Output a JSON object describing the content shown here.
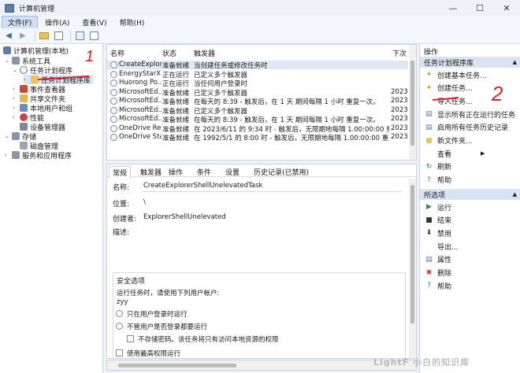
{
  "window": {
    "title": "计算机管理",
    "minimize": "—",
    "maximize": "☐",
    "close": "✕"
  },
  "menu": {
    "file": "文件(F)",
    "action": "操作(A)",
    "view": "查看(V)",
    "help": "帮助(H)"
  },
  "tree": {
    "root": "计算机管理(本地)",
    "system_tools": "系统工具",
    "task_scheduler": "任务计划程序",
    "task_scheduler_library": "任务计划程序库",
    "event_viewer": "事件查看器",
    "shared_folders": "共享文件夹",
    "local_users_groups": "本地用户和组",
    "performance": "性能",
    "device_manager": "设备管理器",
    "storage": "存储",
    "disk_management": "磁盘管理",
    "services_apps": "服务和应用程序"
  },
  "task_list": {
    "headers": {
      "name": "名称",
      "status": "状态",
      "triggers": "触发器",
      "next": "下次"
    },
    "rows": [
      {
        "name": "CreateExplor...",
        "status": "准备就绪",
        "trigger": "当创建任务或修改任务时",
        "next": ""
      },
      {
        "name": "EnergyStarX...",
        "status": "正在运行",
        "trigger": "已定义多个触发器",
        "next": ""
      },
      {
        "name": "Huorong Po...",
        "status": "正在运行",
        "trigger": "当任何用户登录时",
        "next": ""
      },
      {
        "name": "MicrosoftEd...",
        "status": "准备就绪",
        "trigger": "已定义多个触发器",
        "next": "2023,"
      },
      {
        "name": "MicrosoftEd...",
        "status": "准备就绪",
        "trigger": "在每天的 8:39 - 触发后，在 1 天 期间每隔 1 小时 重复一次。",
        "next": "2023,"
      },
      {
        "name": "MicrosoftEd...",
        "status": "准备就绪",
        "trigger": "已定义多个触发器",
        "next": "2023,"
      },
      {
        "name": "MicrosoftEd...",
        "status": "准备就绪",
        "trigger": "在每天的 8:39 - 触发后，在 1 天 期间每隔 1 小时 重复一次。",
        "next": "2023,"
      },
      {
        "name": "OneDrive Re...",
        "status": "准备就绪",
        "trigger": "在 2023/6/11 的 9:34 时 - 触发后，无限期地每隔 1.00:00:00 重复一次。",
        "next": "2023,"
      },
      {
        "name": "OneDrive Sta...",
        "status": "准备就绪",
        "trigger": "在 1992/5/1 的 8:00 时 - 触发后，无限期地每隔 1.00:00:00 重复一次。",
        "next": "2023,"
      }
    ]
  },
  "details": {
    "tabs": [
      "常规",
      "触发器",
      "操作",
      "条件",
      "设置",
      "历史记录(已禁用)"
    ],
    "name_label": "名称:",
    "name_value": "CreateExplorerShellUnelevatedTask",
    "location_label": "位置:",
    "location_value": "\\",
    "author_label": "创建者:",
    "author_value": "ExplorerShellUnelevated",
    "description_label": "描述:",
    "security_title": "安全选项",
    "run_as_label": "运行任务时，请使用下列用户帐户:",
    "run_as_value": "zyy",
    "opt_logged_on": "只在用户登录时运行",
    "opt_whether_logged": "不管用户是否登录都要运行",
    "opt_no_password": "不存储密码。该任务将只有访问本地资源的权限",
    "opt_highest": "使用最高权限运行"
  },
  "actions": {
    "header": "操作",
    "section1": "任务计划程序库",
    "items1": [
      "创建基本任务...",
      "创建任务...",
      "导入任务...",
      "显示所有正在运行的任务",
      "启用所有任务历史记录",
      "新文件夹...",
      "查看",
      "刷新",
      "帮助"
    ],
    "section2": "所选项",
    "items2": [
      "运行",
      "结束",
      "禁用",
      "导出...",
      "属性",
      "删除",
      "帮助"
    ]
  },
  "annotations": {
    "one": "1",
    "two": "2"
  },
  "watermark": "LightF 小白的知识库",
  "icons": [
    "app-icon",
    "back-icon",
    "forward-icon",
    "folder-up-icon",
    "properties-icon",
    "help-icon",
    "clock-icon",
    "folder-icon",
    "delete-icon"
  ],
  "colors": {
    "accent": "#2f6db5",
    "selected_bg": "#d9e7f7",
    "section_bg": "#d8e4f3",
    "annotation_red": "#e0202a",
    "delete_red": "#d42a2a"
  }
}
